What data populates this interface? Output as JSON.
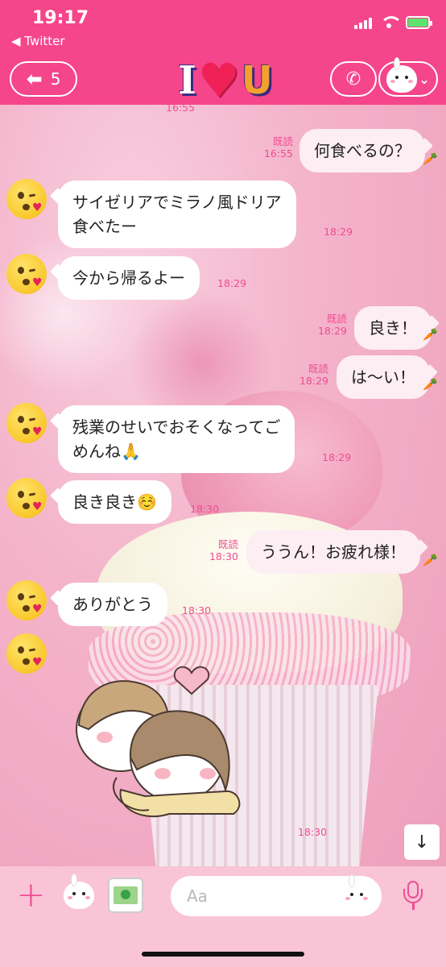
{
  "status_bar": {
    "time": "19:17",
    "back_app": "◀ Twitter"
  },
  "header": {
    "back_count": "5",
    "title_left": "I",
    "title_heart": "♥",
    "title_right": "U"
  },
  "colors": {
    "header_pink": "#f5458b",
    "timestamp_pink": "#f04c92",
    "incoming_bubble": "#ffffff",
    "outgoing_bubble": "#fdeef3"
  },
  "messages": [
    {
      "from": "them",
      "time": "16:55",
      "read": "",
      "text": ""
    },
    {
      "from": "me",
      "read": "既読",
      "time": "16:55",
      "text": "何食べるの？"
    },
    {
      "from": "them",
      "time": "18:29",
      "text": "サイゼリアでミラノ風ドリア\n食べたー"
    },
    {
      "from": "them",
      "time": "18:29",
      "text": "今から帰るよー"
    },
    {
      "from": "me",
      "read": "既読",
      "time": "18:29",
      "text": "良き！"
    },
    {
      "from": "me",
      "read": "既読",
      "time": "18:29",
      "text": "は〜い！"
    },
    {
      "from": "them",
      "time": "18:29",
      "text": "残業のせいでおそくなってご\nめんね🙏"
    },
    {
      "from": "them",
      "time": "18:30",
      "text": "良き良き☺️"
    },
    {
      "from": "me",
      "read": "既読",
      "time": "18:30",
      "text": "ううん！お疲れ様！"
    },
    {
      "from": "them",
      "time": "18:30",
      "text": "ありがとう"
    },
    {
      "from": "them",
      "time": "18:30",
      "text": ""
    }
  ],
  "read_mark": "既読",
  "input": {
    "placeholder": "Aa"
  }
}
